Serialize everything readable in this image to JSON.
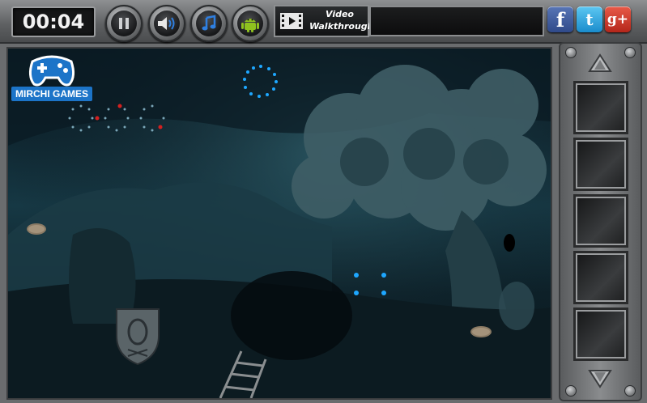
{
  "timer": {
    "value": "00:04"
  },
  "toolbar": {
    "pause_icon": "pause-icon",
    "sound_icon": "speaker-icon",
    "music_icon": "music-note-icon",
    "android_icon": "android-icon",
    "walkthrough_line1": "Video",
    "walkthrough_line2": "Walkthrough"
  },
  "social": {
    "facebook": "f",
    "twitter": "t",
    "googleplus": "g+"
  },
  "logo": {
    "text": "MIRCHI GAMES"
  },
  "colors": {
    "accent": "#1c74c8",
    "scene_dark": "#0c1c24",
    "clue_dot": "#1ea7ff",
    "red_dot": "#d42020",
    "facebook": "#3b5998",
    "twitter": "#2aa9e0",
    "googleplus": "#d23a2a"
  },
  "inventory": {
    "slots": 5
  }
}
